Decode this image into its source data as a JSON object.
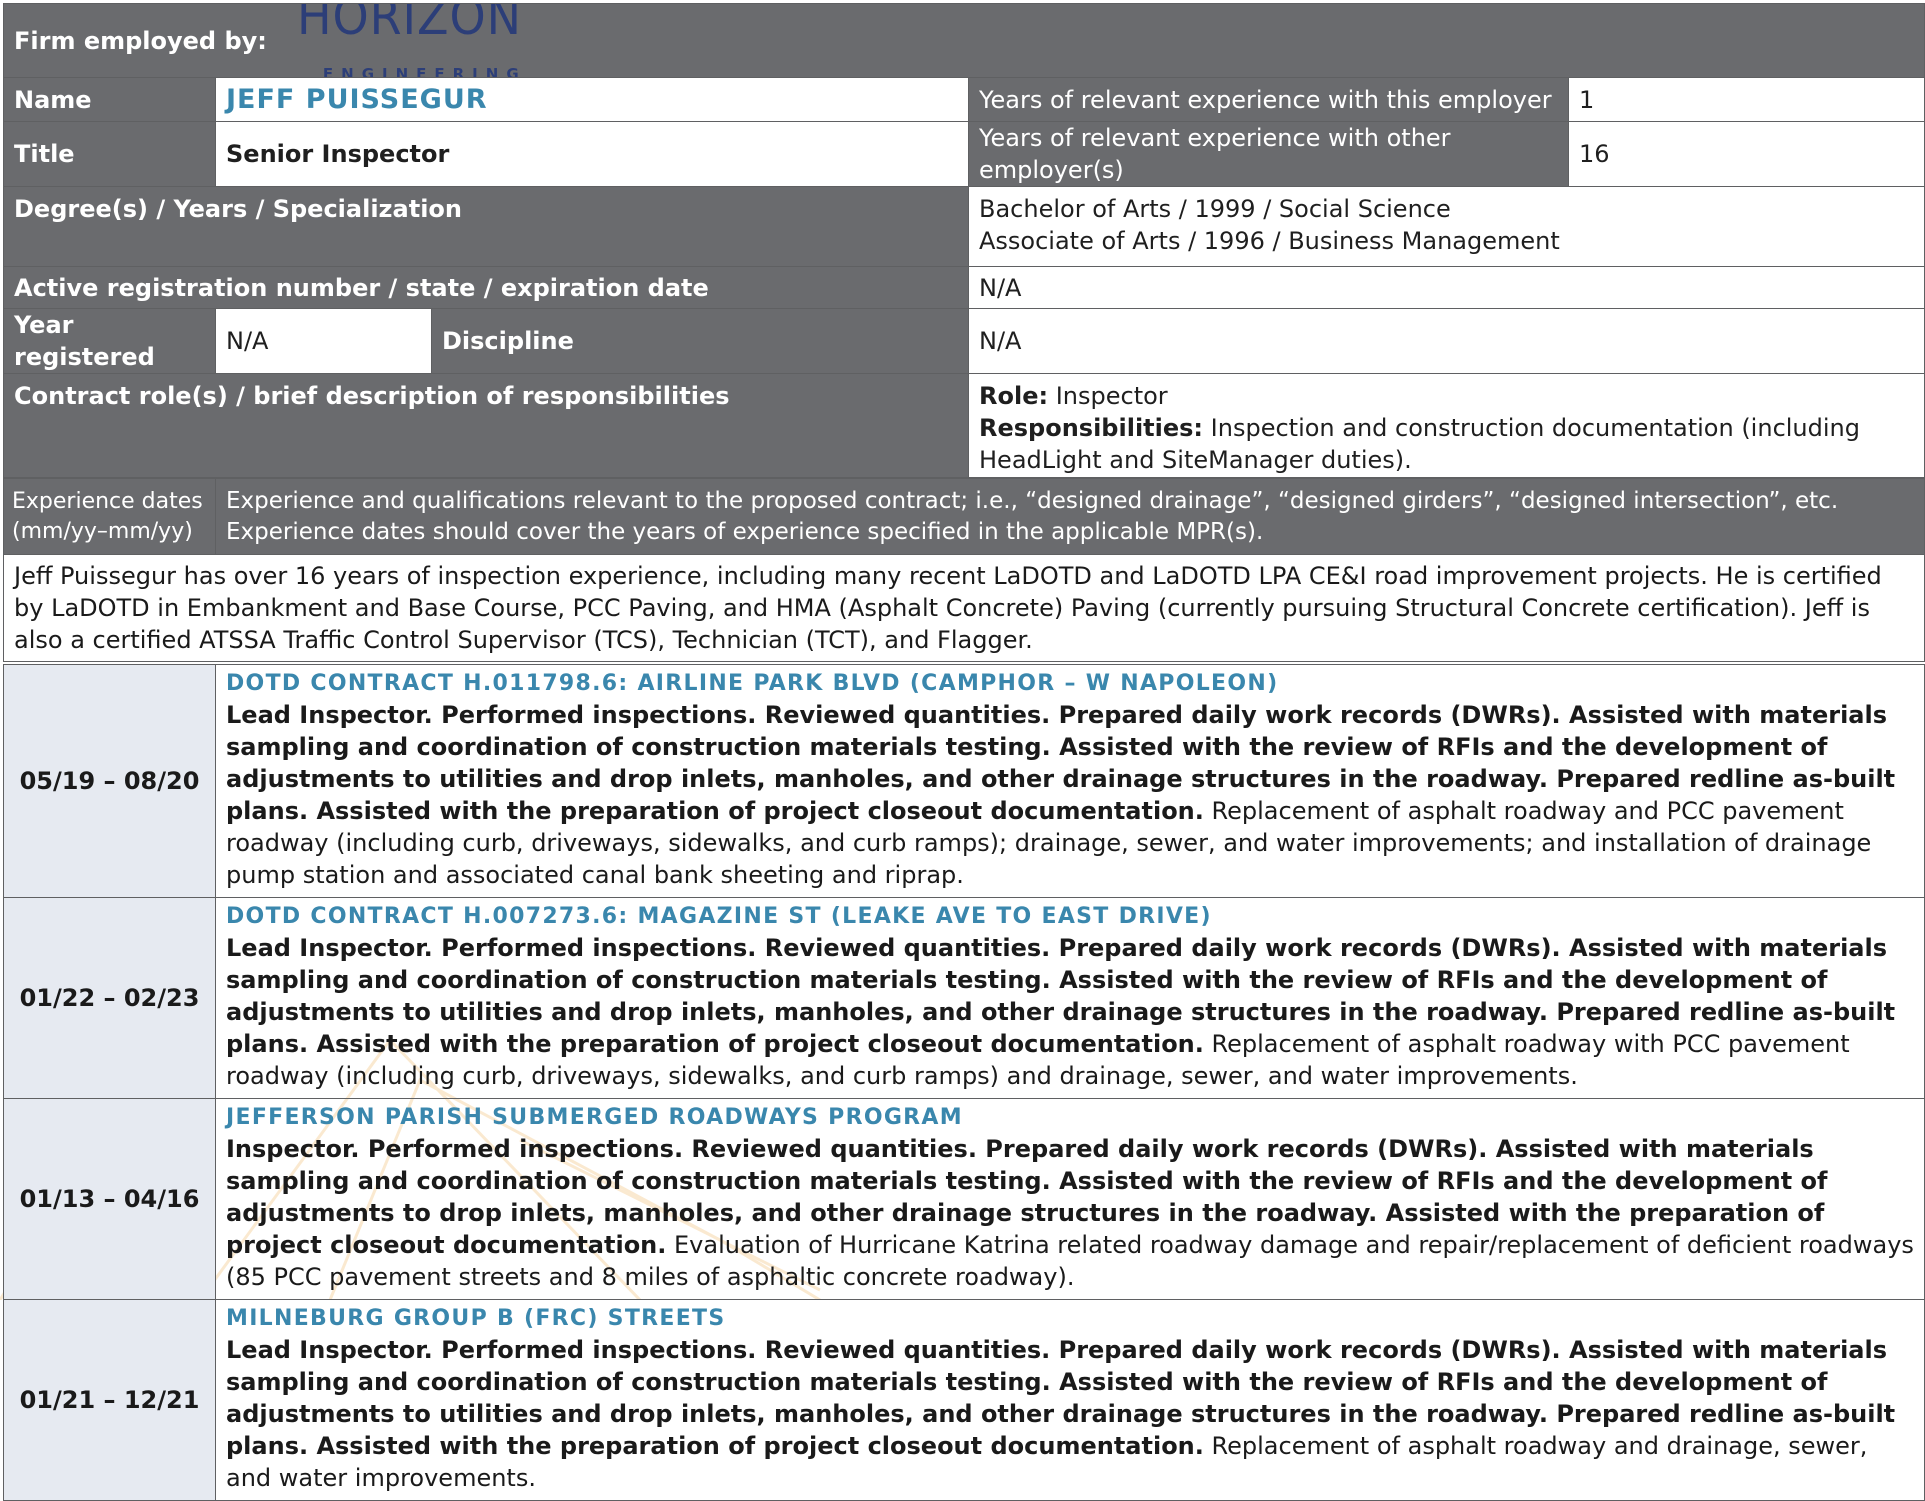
{
  "header": {
    "firm_label": "Firm employed by:",
    "logo_text": "HORIZON",
    "logo_subtext": "ENGINEERING",
    "colors": {
      "header_bg": "#6a6b6e",
      "accent_blue": "#3a87ad",
      "logo_navy": "#2c3e78",
      "date_bg": "#e6eaf1"
    }
  },
  "person": {
    "name_label": "Name",
    "name_value": "JEFF PUISSEGUR",
    "title_label": "Title",
    "title_value": "Senior Inspector",
    "years_this_label": "Years of relevant experience with this employer",
    "years_this_value": "1",
    "years_other_label": "Years of relevant experience with other employer(s)",
    "years_other_value": "16",
    "degree_label": "Degree(s) / Years / Specialization",
    "degree_line1": "Bachelor of Arts / 1999 / Social Science",
    "degree_line2": "Associate of Arts / 1996 / Business Management",
    "registration_label": "Active registration number / state / expiration date",
    "registration_value": "N/A",
    "year_registered_label": "Year registered",
    "year_registered_value": "N/A",
    "discipline_label": "Discipline",
    "discipline_value": "N/A",
    "role_label": "Contract role(s) / brief description of responsibilities",
    "role_prefix": "Role:",
    "role_value": "Inspector",
    "responsibilities_prefix": "Responsibilities:",
    "responsibilities_value": "Inspection and construction documentation (including HeadLight and SiteManager duties)."
  },
  "experience_header": {
    "dates_label_line1": "Experience dates",
    "dates_label_line2": "(mm/yy–mm/yy)",
    "description": "Experience and qualifications relevant to the proposed contract; i.e., “designed drainage”, “designed girders”, “designed intersection”, etc.  Experience dates should cover the years of experience specified in the applicable MPR(s)."
  },
  "summary": "Jeff Puissegur has over 16 years of inspection experience, including many recent LaDOTD and LaDOTD LPA CE&I road improvement projects. He is certified by LaDOTD in Embankment and Base Course, PCC Paving, and HMA (Asphalt Concrete) Paving (currently pursuing Structural Concrete certification). Jeff is also a certified ATSSA Traffic Control Supervisor (TCS), Technician (TCT), and Flagger.",
  "projects": [
    {
      "dates": "05/19 – 08/20",
      "title": "DOTD CONTRACT H.011798.6: AIRLINE PARK BLVD (CAMPHOR – W NAPOLEON)",
      "bold_text": "Lead Inspector. Performed inspections. Reviewed quantities. Prepared daily work records (DWRs). Assisted with materials sampling and coordination of construction materials testing. Assisted with the review of RFIs and the development of adjustments to utilities and drop inlets, manholes, and other drainage structures in the roadway. Prepared redline as-built plans. Assisted with the preparation of project closeout documentation.",
      "normal_text": " Replacement of asphalt roadway and PCC pavement roadway (including curb, driveways, sidewalks, and curb ramps); drainage, sewer, and water improvements; and installation of drainage pump station and associated canal bank sheeting and riprap."
    },
    {
      "dates": "01/22 – 02/23",
      "title": "DOTD CONTRACT H.007273.6: MAGAZINE ST (LEAKE AVE TO EAST DRIVE)",
      "bold_text": "Lead Inspector. Performed inspections. Reviewed quantities. Prepared daily work records (DWRs). Assisted with materials sampling and coordination of construction materials testing. Assisted with the review of RFIs and the development of adjustments to utilities and drop inlets, manholes, and other drainage structures in the roadway. Prepared redline as-built plans. Assisted with the preparation of project closeout documentation.",
      "normal_text": "  Replacement of asphalt roadway with PCC pavement roadway (including curb, driveways, sidewalks, and curb ramps) and drainage, sewer, and water improvements."
    },
    {
      "dates": "01/13 – 04/16",
      "title": "JEFFERSON PARISH SUBMERGED ROADWAYS PROGRAM",
      "bold_text": "Inspector. Performed inspections. Reviewed quantities. Prepared daily work records (DWRs). Assisted with materials sampling and coordination of construction materials testing. Assisted with the review of RFIs and the development of adjustments to drop inlets, manholes, and other drainage structures in the roadway. Assisted with the preparation of project closeout documentation.",
      "normal_text": " Evaluation of Hurricane Katrina related roadway damage and repair/replacement of deficient roadways (85 PCC pavement streets and 8 miles of asphaltic concrete roadway)."
    },
    {
      "dates": "01/21 – 12/21",
      "title": "MILNEBURG GROUP B (FRC) STREETS",
      "bold_text": "Lead Inspector. Performed inspections. Reviewed quantities. Prepared daily work records (DWRs). Assisted with materials sampling and coordination of construction materials testing. Assisted with the review of RFIs and the development of adjustments to utilities and drop inlets, manholes, and other drainage structures in the roadway. Prepared redline as-built plans. Assisted with the preparation of project closeout documentation.",
      "normal_text": " Replacement of asphalt roadway and drainage, sewer, and water improvements."
    }
  ]
}
